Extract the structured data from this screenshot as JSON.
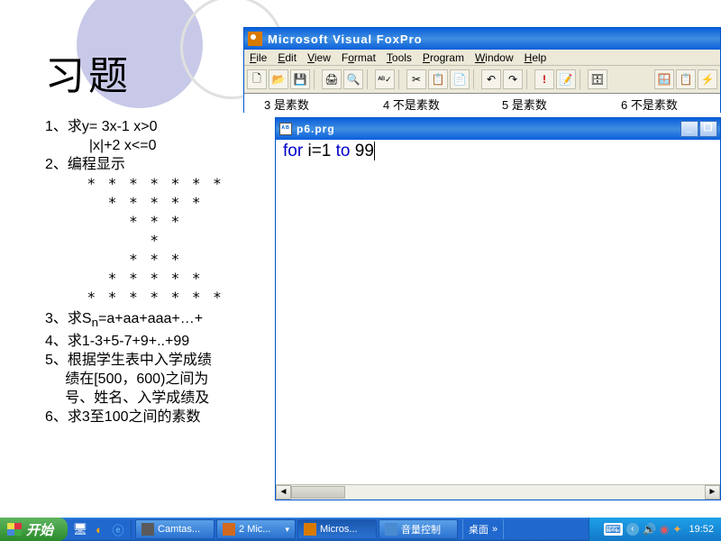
{
  "doc": {
    "title": "习题",
    "items": [
      "1、求y=  3x-1 x>0",
      "           |x|+2 x<=0",
      "2、编程显示",
      "    * * * * * * *",
      "      * * * * *",
      "        * * *",
      "          *",
      "        * * *",
      "      * * * * *",
      "    * * * * * * *",
      "3、求Sn=a+aa+aaa+…+",
      "4、求1-3+5-7+9+..+99",
      "5、根据学生表中入学成绩",
      "     绩在[500，600)之间为",
      "     号、姓名、入学成绩及",
      "6、求3至100之间的素数"
    ]
  },
  "foxpro": {
    "title": "Microsoft Visual FoxPro",
    "menus": [
      "File",
      "Edit",
      "View",
      "Format",
      "Tools",
      "Program",
      "Window",
      "Help"
    ],
    "results": [
      "3 是素数",
      "4 不是素数",
      "5 是素数",
      "6 不是素数"
    ]
  },
  "codewin": {
    "title": "p6.prg",
    "btns": {
      "min": "_",
      "max": "❐"
    },
    "code": {
      "kw1": "for",
      "mid": " i=1 ",
      "kw2": "to",
      "num": " 99"
    }
  },
  "taskbar": {
    "start": "开始",
    "buttons": [
      {
        "label": "Camtas...",
        "color": "#5a5a5a"
      },
      {
        "label": "2 Mic...",
        "color": "#d2691e",
        "active": false,
        "drop": true
      },
      {
        "label": "Micros...",
        "color": "#d97a00",
        "active": true
      },
      {
        "label": "音量控制",
        "color": "#4a8ad0"
      }
    ],
    "desk": "桌面",
    "clock": "19:52"
  }
}
